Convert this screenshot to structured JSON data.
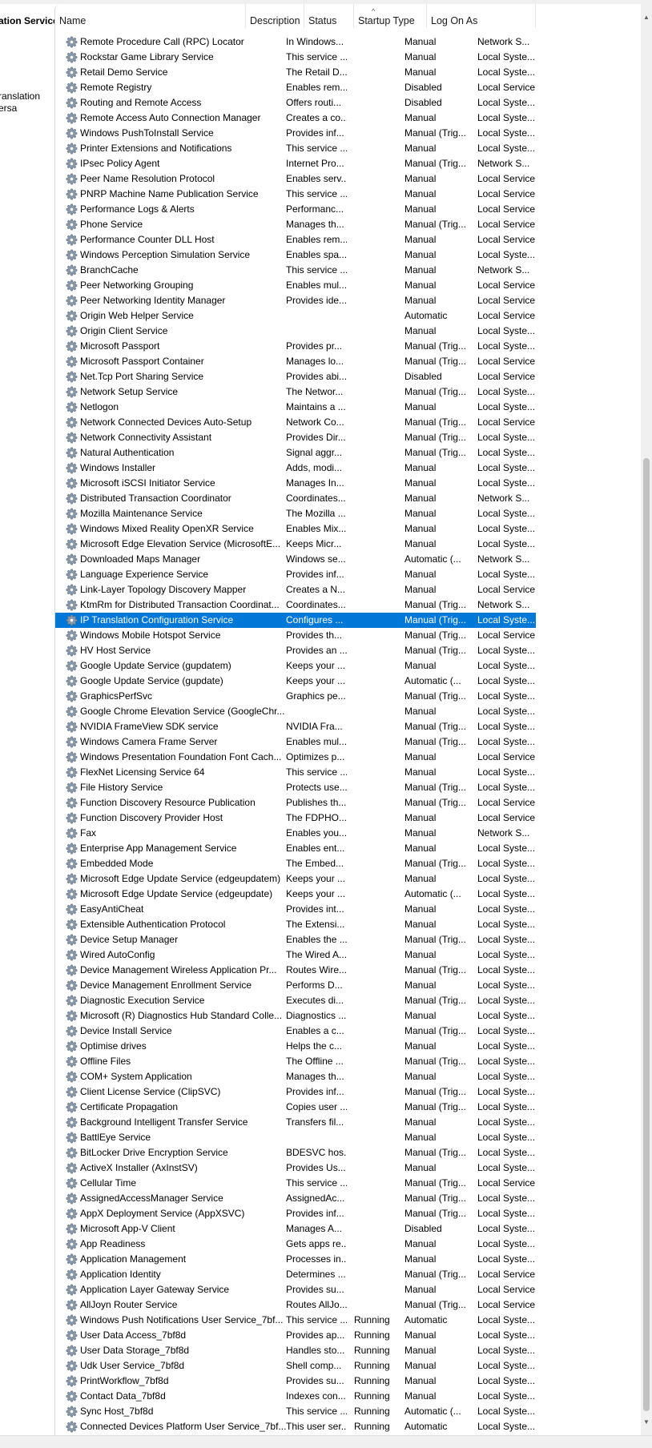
{
  "left_pane": {
    "title": "ation Service",
    "description": "ranslation ersa"
  },
  "columns": {
    "name": "Name",
    "description": "Description",
    "status": "Status",
    "startup_type": "Startup Type",
    "log_on_as": "Log On As"
  },
  "sort_indicator": "^",
  "icons": {
    "row_icon": "gear-service-icon",
    "scroll_up": "chevron-up-icon",
    "scroll_down": "chevron-down-icon"
  },
  "colors": {
    "selected_row": "#0078d7",
    "selected_text": "#ffffff"
  },
  "selected_row_index": 38,
  "rows": [
    [
      "Remote Procedure Call (RPC) Locator",
      "In Windows...",
      "",
      "Manual",
      "Network S..."
    ],
    [
      "Rockstar Game Library Service",
      "This service ...",
      "",
      "Manual",
      "Local Syste..."
    ],
    [
      "Retail Demo Service",
      "The Retail D...",
      "",
      "Manual",
      "Local Syste..."
    ],
    [
      "Remote Registry",
      "Enables rem...",
      "",
      "Disabled",
      "Local Service"
    ],
    [
      "Routing and Remote Access",
      "Offers routi...",
      "",
      "Disabled",
      "Local Syste..."
    ],
    [
      "Remote Access Auto Connection Manager",
      "Creates a co...",
      "",
      "Manual",
      "Local Syste..."
    ],
    [
      "Windows PushToInstall Service",
      "Provides inf...",
      "",
      "Manual (Trig...",
      "Local Syste..."
    ],
    [
      "Printer Extensions and Notifications",
      "This service ...",
      "",
      "Manual",
      "Local Syste..."
    ],
    [
      "IPsec Policy Agent",
      "Internet Pro...",
      "",
      "Manual (Trig...",
      "Network S..."
    ],
    [
      "Peer Name Resolution Protocol",
      "Enables serv...",
      "",
      "Manual",
      "Local Service"
    ],
    [
      "PNRP Machine Name Publication Service",
      "This service ...",
      "",
      "Manual",
      "Local Service"
    ],
    [
      "Performance Logs & Alerts",
      "Performanc...",
      "",
      "Manual",
      "Local Service"
    ],
    [
      "Phone Service",
      "Manages th...",
      "",
      "Manual (Trig...",
      "Local Service"
    ],
    [
      "Performance Counter DLL Host",
      "Enables rem...",
      "",
      "Manual",
      "Local Service"
    ],
    [
      "Windows Perception Simulation Service",
      "Enables spa...",
      "",
      "Manual",
      "Local Syste..."
    ],
    [
      "BranchCache",
      "This service ...",
      "",
      "Manual",
      "Network S..."
    ],
    [
      "Peer Networking Grouping",
      "Enables mul...",
      "",
      "Manual",
      "Local Service"
    ],
    [
      "Peer Networking Identity Manager",
      "Provides ide...",
      "",
      "Manual",
      "Local Service"
    ],
    [
      "Origin Web Helper Service",
      "",
      "",
      "Automatic",
      "Local Service"
    ],
    [
      "Origin Client Service",
      "",
      "",
      "Manual",
      "Local Syste..."
    ],
    [
      "Microsoft Passport",
      "Provides pr...",
      "",
      "Manual (Trig...",
      "Local Syste..."
    ],
    [
      "Microsoft Passport Container",
      "Manages lo...",
      "",
      "Manual (Trig...",
      "Local Service"
    ],
    [
      "Net.Tcp Port Sharing Service",
      "Provides abi...",
      "",
      "Disabled",
      "Local Service"
    ],
    [
      "Network Setup Service",
      "The Networ...",
      "",
      "Manual (Trig...",
      "Local Syste..."
    ],
    [
      "Netlogon",
      "Maintains a ...",
      "",
      "Manual",
      "Local Syste..."
    ],
    [
      "Network Connected Devices Auto-Setup",
      "Network Co...",
      "",
      "Manual (Trig...",
      "Local Service"
    ],
    [
      "Network Connectivity Assistant",
      "Provides Dir...",
      "",
      "Manual (Trig...",
      "Local Syste..."
    ],
    [
      "Natural Authentication",
      "Signal aggr...",
      "",
      "Manual (Trig...",
      "Local Syste..."
    ],
    [
      "Windows Installer",
      "Adds, modi...",
      "",
      "Manual",
      "Local Syste..."
    ],
    [
      "Microsoft iSCSI Initiator Service",
      "Manages In...",
      "",
      "Manual",
      "Local Syste..."
    ],
    [
      "Distributed Transaction Coordinator",
      "Coordinates...",
      "",
      "Manual",
      "Network S..."
    ],
    [
      "Mozilla Maintenance Service",
      "The Mozilla ...",
      "",
      "Manual",
      "Local Syste..."
    ],
    [
      "Windows Mixed Reality OpenXR Service",
      "Enables Mix...",
      "",
      "Manual",
      "Local Syste..."
    ],
    [
      "Microsoft Edge Elevation Service (MicrosoftE...",
      "Keeps Micr...",
      "",
      "Manual",
      "Local Syste..."
    ],
    [
      "Downloaded Maps Manager",
      "Windows se...",
      "",
      "Automatic (...",
      "Network S..."
    ],
    [
      "Language Experience Service",
      "Provides inf...",
      "",
      "Manual",
      "Local Syste..."
    ],
    [
      "Link-Layer Topology Discovery Mapper",
      "Creates a N...",
      "",
      "Manual",
      "Local Service"
    ],
    [
      "KtmRm for Distributed Transaction Coordinat...",
      "Coordinates...",
      "",
      "Manual (Trig...",
      "Network S..."
    ],
    [
      "IP Translation Configuration Service",
      "Configures ...",
      "",
      "Manual (Trig...",
      "Local Syste..."
    ],
    [
      "Windows Mobile Hotspot Service",
      "Provides th...",
      "",
      "Manual (Trig...",
      "Local Service"
    ],
    [
      "HV Host Service",
      "Provides an ...",
      "",
      "Manual (Trig...",
      "Local Syste..."
    ],
    [
      "Google Update Service (gupdatem)",
      "Keeps your ...",
      "",
      "Manual",
      "Local Syste..."
    ],
    [
      "Google Update Service (gupdate)",
      "Keeps your ...",
      "",
      "Automatic (...",
      "Local Syste..."
    ],
    [
      "GraphicsPerfSvc",
      "Graphics pe...",
      "",
      "Manual (Trig...",
      "Local Syste..."
    ],
    [
      "Google Chrome Elevation Service (GoogleChr...",
      "",
      "",
      "Manual",
      "Local Syste..."
    ],
    [
      "NVIDIA FrameView SDK service",
      "NVIDIA Fra...",
      "",
      "Manual (Trig...",
      "Local Syste..."
    ],
    [
      "Windows Camera Frame Server",
      "Enables mul...",
      "",
      "Manual (Trig...",
      "Local Syste..."
    ],
    [
      "Windows Presentation Foundation Font Cach...",
      "Optimizes p...",
      "",
      "Manual",
      "Local Service"
    ],
    [
      "FlexNet Licensing Service 64",
      "This service ...",
      "",
      "Manual",
      "Local Syste..."
    ],
    [
      "File History Service",
      "Protects use...",
      "",
      "Manual (Trig...",
      "Local Syste..."
    ],
    [
      "Function Discovery Resource Publication",
      "Publishes th...",
      "",
      "Manual (Trig...",
      "Local Service"
    ],
    [
      "Function Discovery Provider Host",
      "The FDPHO...",
      "",
      "Manual",
      "Local Service"
    ],
    [
      "Fax",
      "Enables you...",
      "",
      "Manual",
      "Network S..."
    ],
    [
      "Enterprise App Management Service",
      "Enables ent...",
      "",
      "Manual",
      "Local Syste..."
    ],
    [
      "Embedded Mode",
      "The Embed...",
      "",
      "Manual (Trig...",
      "Local Syste..."
    ],
    [
      "Microsoft Edge Update Service (edgeupdatem)",
      "Keeps your ...",
      "",
      "Manual",
      "Local Syste..."
    ],
    [
      "Microsoft Edge Update Service (edgeupdate)",
      "Keeps your ...",
      "",
      "Automatic (...",
      "Local Syste..."
    ],
    [
      "EasyAntiCheat",
      "Provides int...",
      "",
      "Manual",
      "Local Syste..."
    ],
    [
      "Extensible Authentication Protocol",
      "The Extensi...",
      "",
      "Manual",
      "Local Syste..."
    ],
    [
      "Device Setup Manager",
      "Enables the ...",
      "",
      "Manual (Trig...",
      "Local Syste..."
    ],
    [
      "Wired AutoConfig",
      "The Wired A...",
      "",
      "Manual",
      "Local Syste..."
    ],
    [
      "Device Management Wireless Application Pr...",
      "Routes Wire...",
      "",
      "Manual (Trig...",
      "Local Syste..."
    ],
    [
      "Device Management Enrollment Service",
      "Performs D...",
      "",
      "Manual",
      "Local Syste..."
    ],
    [
      "Diagnostic Execution Service",
      "Executes di...",
      "",
      "Manual (Trig...",
      "Local Syste..."
    ],
    [
      "Microsoft (R) Diagnostics Hub Standard Colle...",
      "Diagnostics ...",
      "",
      "Manual",
      "Local Syste..."
    ],
    [
      "Device Install Service",
      "Enables a c...",
      "",
      "Manual (Trig...",
      "Local Syste..."
    ],
    [
      "Optimise drives",
      "Helps the c...",
      "",
      "Manual",
      "Local Syste..."
    ],
    [
      "Offline Files",
      "The Offline ...",
      "",
      "Manual (Trig...",
      "Local Syste..."
    ],
    [
      "COM+ System Application",
      "Manages th...",
      "",
      "Manual",
      "Local Syste..."
    ],
    [
      "Client License Service (ClipSVC)",
      "Provides inf...",
      "",
      "Manual (Trig...",
      "Local Syste..."
    ],
    [
      "Certificate Propagation",
      "Copies user ...",
      "",
      "Manual (Trig...",
      "Local Syste..."
    ],
    [
      "Background Intelligent Transfer Service",
      "Transfers fil...",
      "",
      "Manual",
      "Local Syste..."
    ],
    [
      "BattlEye Service",
      "",
      "",
      "Manual",
      "Local Syste..."
    ],
    [
      "BitLocker Drive Encryption Service",
      "BDESVC hos...",
      "",
      "Manual (Trig...",
      "Local Syste..."
    ],
    [
      "ActiveX Installer (AxInstSV)",
      "Provides Us...",
      "",
      "Manual",
      "Local Syste..."
    ],
    [
      "Cellular Time",
      "This service ...",
      "",
      "Manual (Trig...",
      "Local Service"
    ],
    [
      "AssignedAccessManager Service",
      "AssignedAc...",
      "",
      "Manual (Trig...",
      "Local Syste..."
    ],
    [
      "AppX Deployment Service (AppXSVC)",
      "Provides inf...",
      "",
      "Manual (Trig...",
      "Local Syste..."
    ],
    [
      "Microsoft App-V Client",
      "Manages A...",
      "",
      "Disabled",
      "Local Syste..."
    ],
    [
      "App Readiness",
      "Gets apps re...",
      "",
      "Manual",
      "Local Syste..."
    ],
    [
      "Application Management",
      "Processes in...",
      "",
      "Manual",
      "Local Syste..."
    ],
    [
      "Application Identity",
      "Determines ...",
      "",
      "Manual (Trig...",
      "Local Service"
    ],
    [
      "Application Layer Gateway Service",
      "Provides su...",
      "",
      "Manual",
      "Local Service"
    ],
    [
      "AllJoyn Router Service",
      "Routes AllJo...",
      "",
      "Manual (Trig...",
      "Local Service"
    ],
    [
      "Windows Push Notifications User Service_7bf...",
      "This service ...",
      "Running",
      "Automatic",
      "Local Syste..."
    ],
    [
      "User Data Access_7bf8d",
      "Provides ap...",
      "Running",
      "Manual",
      "Local Syste..."
    ],
    [
      "User Data Storage_7bf8d",
      "Handles sto...",
      "Running",
      "Manual",
      "Local Syste..."
    ],
    [
      "Udk User Service_7bf8d",
      "Shell comp...",
      "Running",
      "Manual",
      "Local Syste..."
    ],
    [
      "PrintWorkflow_7bf8d",
      "Provides su...",
      "Running",
      "Manual",
      "Local Syste..."
    ],
    [
      "Contact Data_7bf8d",
      "Indexes con...",
      "Running",
      "Manual",
      "Local Syste..."
    ],
    [
      "Sync Host_7bf8d",
      "This service ...",
      "Running",
      "Automatic (...",
      "Local Syste..."
    ],
    [
      "Connected Devices Platform User Service_7bf...",
      "This user ser...",
      "Running",
      "Automatic",
      "Local Syste..."
    ]
  ]
}
